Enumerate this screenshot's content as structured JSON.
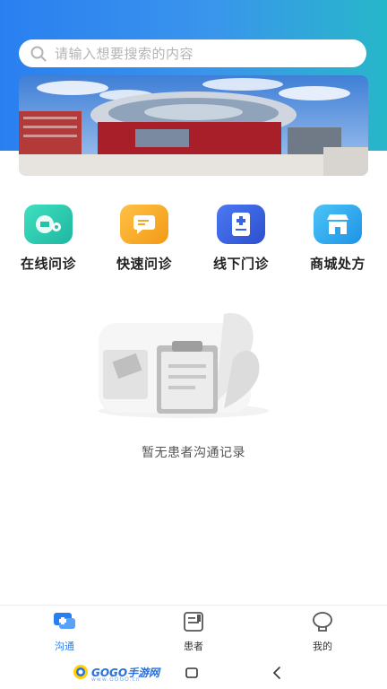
{
  "search": {
    "placeholder": "请输入想要搜索的内容"
  },
  "quick_actions": [
    {
      "label": "在线问诊",
      "icon": "online-consult-icon",
      "color": "#22c3a6"
    },
    {
      "label": "快速问诊",
      "icon": "quick-consult-icon",
      "color": "#f5a623"
    },
    {
      "label": "线下门诊",
      "icon": "offline-clinic-icon",
      "color": "#3a63e0"
    },
    {
      "label": "商城处方",
      "icon": "store-icon",
      "color": "#2aa5ec"
    }
  ],
  "empty_state": {
    "text": "暂无患者沟通记录"
  },
  "tabbar": {
    "items": [
      {
        "label": "沟通",
        "active": true
      },
      {
        "label": "患者",
        "active": false
      },
      {
        "label": "我的",
        "active": false
      }
    ]
  },
  "watermark": {
    "text": "GOGO手游网",
    "sub": "www.GOGO.cn"
  },
  "colors": {
    "brand": "#2a7ff0",
    "accent": "#27b7c9"
  }
}
